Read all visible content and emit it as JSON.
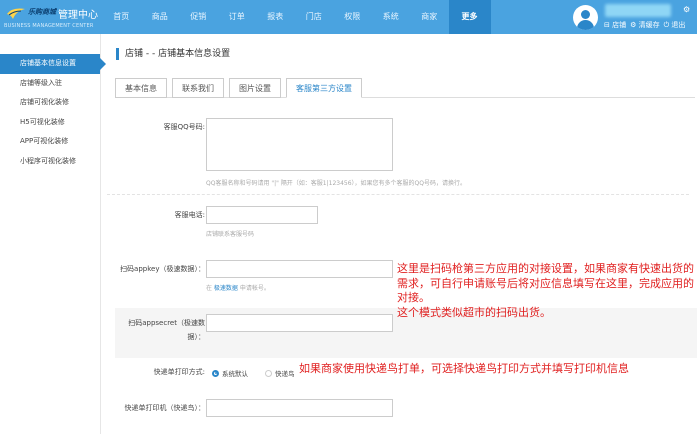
{
  "header": {
    "logo_brand": "乐购商城",
    "logo_title": "管理中心",
    "logo_sub": "BUSINESS MANAGEMENT CENTER",
    "nav": [
      "首页",
      "商品",
      "促销",
      "订单",
      "报表",
      "门店",
      "权限",
      "系统",
      "商家",
      "更多"
    ],
    "links": [
      "店铺",
      "清缓存",
      "退出"
    ]
  },
  "sidebar": {
    "items": [
      "店铺基本信息设置",
      "店铺等级入驻",
      "店铺可视化装修",
      "H5可视化装修",
      "APP可视化装修",
      "小程序可视化装修"
    ]
  },
  "page": {
    "title": "店铺 - - 店铺基本信息设置",
    "tabs": [
      "基本信息",
      "联系我们",
      "图片设置",
      "客服第三方设置"
    ]
  },
  "form": {
    "qq_label": "客服QQ号码:",
    "qq_hint": "QQ客服名称和号码请用 \"|\" 隔开（如：客服1|123456），如果您有多个客服的QQ号码，请换行。",
    "phone_label": "客服电话:",
    "phone_hint": "店铺联系客服号码",
    "appkey_label": "扫码appkey（极速数据）：",
    "appkey_hint_pre": "在 ",
    "appkey_hint_link": "极速数据",
    "appkey_hint_post": " 申请帐号。",
    "appsecret_label": "扫码appsecret（极速数据）：",
    "print_label": "快递单打印方式:",
    "print_opt1": "系统默认",
    "print_opt2": "快递鸟",
    "printer_label": "快递单打印机（快递鸟）："
  },
  "notes": {
    "note1": "这里是扫码枪第三方应用的对接设置，如果商家有快速出货的需求，可自行申请账号后将对应信息填写在这里，完成应用的对接。",
    "note2": "这个模式类似超市的扫码出货。",
    "note3": "如果商家使用快递鸟打单，可选择快递鸟打印方式并填写打印机信息"
  },
  "colors": {
    "topbar": "#4aa3e0",
    "accent": "#2a86c9",
    "annotation": "#e02020"
  }
}
